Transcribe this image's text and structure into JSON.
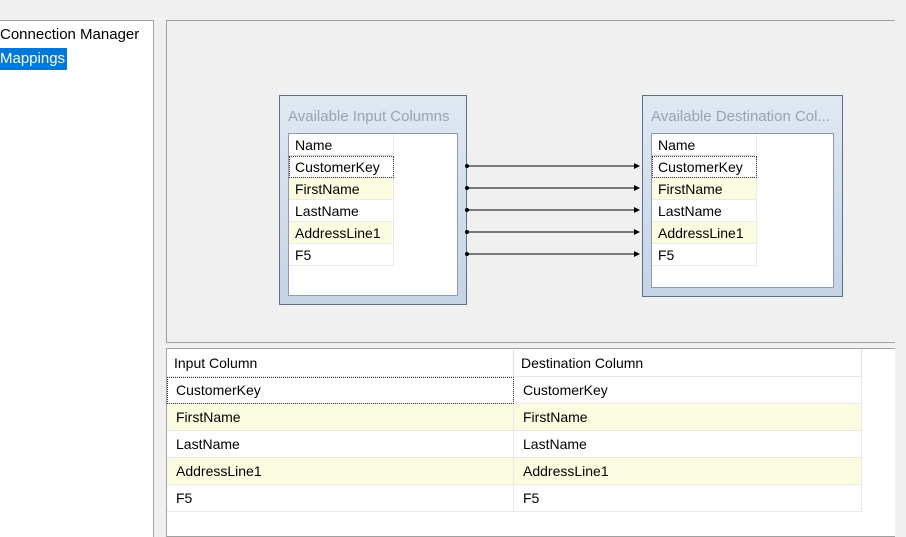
{
  "nav": {
    "items": [
      {
        "label": "Connection Manager",
        "selected": false
      },
      {
        "label": "Mappings",
        "selected": true
      }
    ]
  },
  "diagram": {
    "input_box": {
      "title": "Available Input Columns",
      "header": "Name",
      "rows": [
        "CustomerKey",
        "FirstName",
        "LastName",
        "AddressLine1",
        "F5"
      ]
    },
    "dest_box": {
      "title": "Available Destination Col...",
      "header": "Name",
      "rows": [
        "CustomerKey",
        "FirstName",
        "LastName",
        "AddressLine1",
        "F5"
      ]
    }
  },
  "grid": {
    "headers": {
      "input": "Input Column",
      "destination": "Destination Column"
    },
    "rows": [
      {
        "input": "CustomerKey",
        "destination": "CustomerKey"
      },
      {
        "input": "FirstName",
        "destination": "FirstName"
      },
      {
        "input": "LastName",
        "destination": "LastName"
      },
      {
        "input": "AddressLine1",
        "destination": "AddressLine1"
      },
      {
        "input": "F5",
        "destination": "F5"
      }
    ]
  },
  "colors": {
    "selection": "#0078d7",
    "alt_row": "#fcfce0"
  }
}
